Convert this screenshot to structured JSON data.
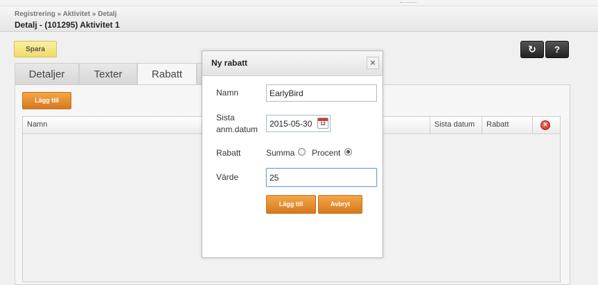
{
  "header": {
    "breadcrumb": "Registrering » Aktivitet » Detalj",
    "title": "Detalj - (101295) Aktivitet 1"
  },
  "toolbar": {
    "save_label": "Spara",
    "refresh_icon": "↻",
    "help_label": "?"
  },
  "tabs": [
    {
      "label": "Detaljer",
      "active": false
    },
    {
      "label": "Texter",
      "active": false
    },
    {
      "label": "Rabatt",
      "active": true
    }
  ],
  "rabatt_panel": {
    "add_label": "Lägg till",
    "columns": [
      "Namn",
      "Sista datum",
      "Rabatt"
    ]
  },
  "dialog": {
    "title": "Ny rabatt",
    "close_label": "×",
    "namn_label": "Namn",
    "namn_value": "EarlyBird",
    "sista_label_line1": "Sista",
    "sista_label_line2": "anm.datum",
    "date_value": "2015-05-30",
    "calendar_day": "12",
    "rabatt_label": "Rabatt",
    "summa_label": "Summa",
    "procent_label": "Procent",
    "selected_type": "Procent",
    "varde_label": "Värde",
    "varde_value": "25",
    "add_label": "Lägg till",
    "cancel_label": "Avbryt"
  },
  "colors": {
    "accent_orange": "#e08a2e",
    "save_yellow": "#f3e07d",
    "dark_button": "#333333",
    "delete_red": "#d9342b"
  }
}
